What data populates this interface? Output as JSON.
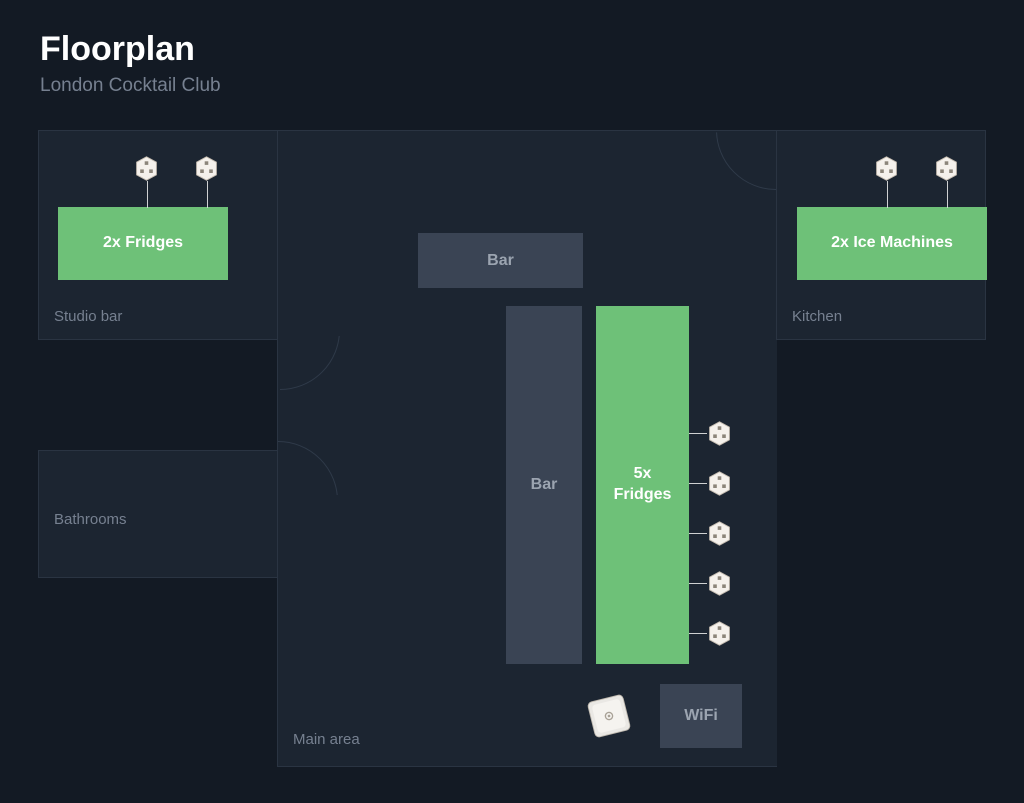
{
  "header": {
    "title": "Floorplan",
    "subtitle": "London Cocktail Club"
  },
  "rooms": {
    "studio_bar": "Studio bar",
    "bathrooms": "Bathrooms",
    "kitchen": "Kitchen",
    "main_area": "Main area"
  },
  "blocks": {
    "bar_top": "Bar",
    "bar_side": "Bar",
    "wifi": "WiFi"
  },
  "equipment": {
    "studio_fridges": "2x Fridges",
    "ice_machines": "2x Ice Machines",
    "main_fridges": "5x\nFridges"
  }
}
